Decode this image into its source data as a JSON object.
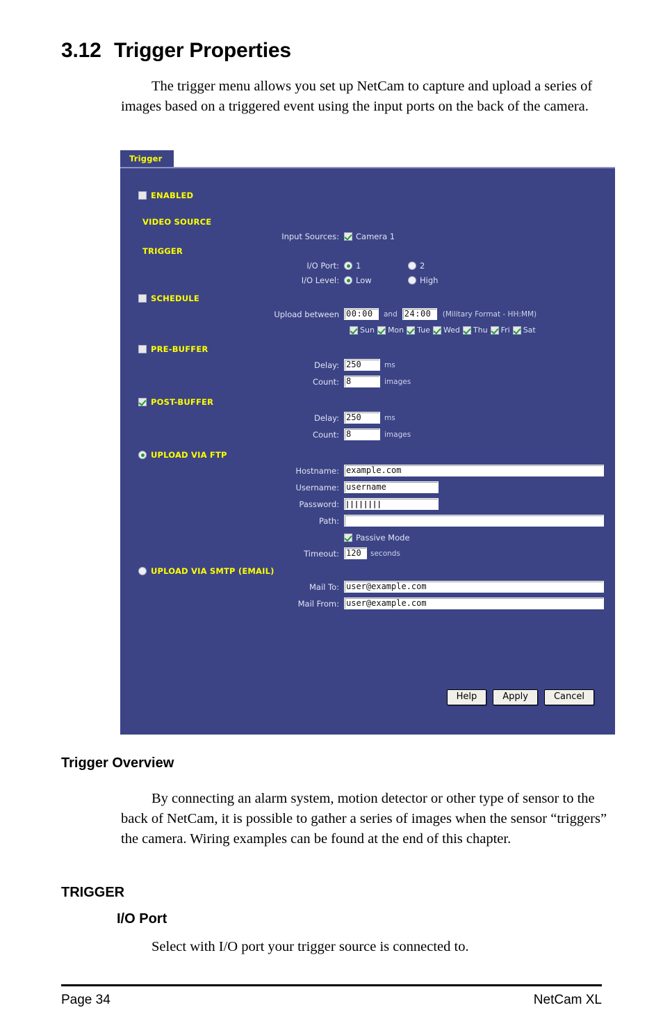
{
  "document": {
    "section_number": "3.12",
    "section_title": "Trigger Properties",
    "intro_paragraph": "The trigger menu allows you set up NetCam to capture and upload a series of images based on a triggered event using the input ports on the back of the camera.",
    "trigger_overview_heading": "Trigger Overview",
    "trigger_overview_paragraph": "By connecting an alarm system, motion detector or other type of sensor to the back of NetCam, it is possible to gather a series of images when the sensor “triggers” the camera. Wiring examples can be found at the end of this chapter.",
    "trigger_heading": "TRIGGER",
    "io_port_heading": "I/O Port",
    "io_port_paragraph": "Select with I/O port your trigger source is connected to.",
    "footer_left": "Page 34",
    "footer_right": "NetCam XL"
  },
  "screenshot": {
    "tab_label": "Trigger",
    "colors": {
      "panel_bg": "#3c4486",
      "section_heading": "#ffff00",
      "label_text": "#e2e4f2",
      "check_green": "#1f9b33",
      "button_face": "#f0efe9"
    },
    "enabled": {
      "label": "ENABLED",
      "checked": false
    },
    "video_source": {
      "heading": "VIDEO SOURCE",
      "input_sources_label": "Input Sources:",
      "camera": {
        "label": "Camera 1",
        "checked": true
      }
    },
    "trigger": {
      "heading": "TRIGGER",
      "io_port_label": "I/O Port:",
      "io_port_options": [
        {
          "label": "1",
          "selected": true
        },
        {
          "label": "2",
          "selected": false
        }
      ],
      "io_level_label": "I/O Level:",
      "io_level_options": [
        {
          "label": "Low",
          "selected": true
        },
        {
          "label": "High",
          "selected": false
        }
      ]
    },
    "schedule": {
      "heading": "SCHEDULE",
      "checked": false,
      "upload_between_label": "Upload between",
      "start_time": "00:00",
      "and_label": "and",
      "end_time": "24:00",
      "format_note": "(Military Format - HH:MM)",
      "days": [
        {
          "label": "Sun",
          "checked": true
        },
        {
          "label": "Mon",
          "checked": true
        },
        {
          "label": "Tue",
          "checked": true
        },
        {
          "label": "Wed",
          "checked": true
        },
        {
          "label": "Thu",
          "checked": true
        },
        {
          "label": "Fri",
          "checked": true
        },
        {
          "label": "Sat",
          "checked": true
        }
      ]
    },
    "pre_buffer": {
      "heading": "PRE-BUFFER",
      "checked": false,
      "delay_label": "Delay:",
      "delay_value": "250",
      "delay_unit": "ms",
      "count_label": "Count:",
      "count_value": "8",
      "count_unit": "images"
    },
    "post_buffer": {
      "heading": "POST-BUFFER",
      "checked": true,
      "delay_label": "Delay:",
      "delay_value": "250",
      "delay_unit": "ms",
      "count_label": "Count:",
      "count_value": "8",
      "count_unit": "images"
    },
    "upload_ftp": {
      "heading": "UPLOAD VIA FTP",
      "selected": true,
      "hostname_label": "Hostname:",
      "hostname_value": "example.com",
      "username_label": "Username:",
      "username_value": "username",
      "password_label": "Password:",
      "password_value": "████████",
      "password_mask": "||||||||",
      "path_label": "Path:",
      "path_value": "",
      "passive_mode_label": "Passive Mode",
      "passive_mode_checked": true,
      "timeout_label": "Timeout:",
      "timeout_value": "120",
      "timeout_unit": "seconds"
    },
    "upload_smtp": {
      "heading": "UPLOAD VIA SMTP (EMAIL)",
      "selected": false,
      "mail_to_label": "Mail To:",
      "mail_to_value": "user@example.com",
      "mail_from_label": "Mail From:",
      "mail_from_value": "user@example.com"
    },
    "buttons": {
      "help": "Help",
      "apply": "Apply",
      "cancel": "Cancel"
    }
  }
}
